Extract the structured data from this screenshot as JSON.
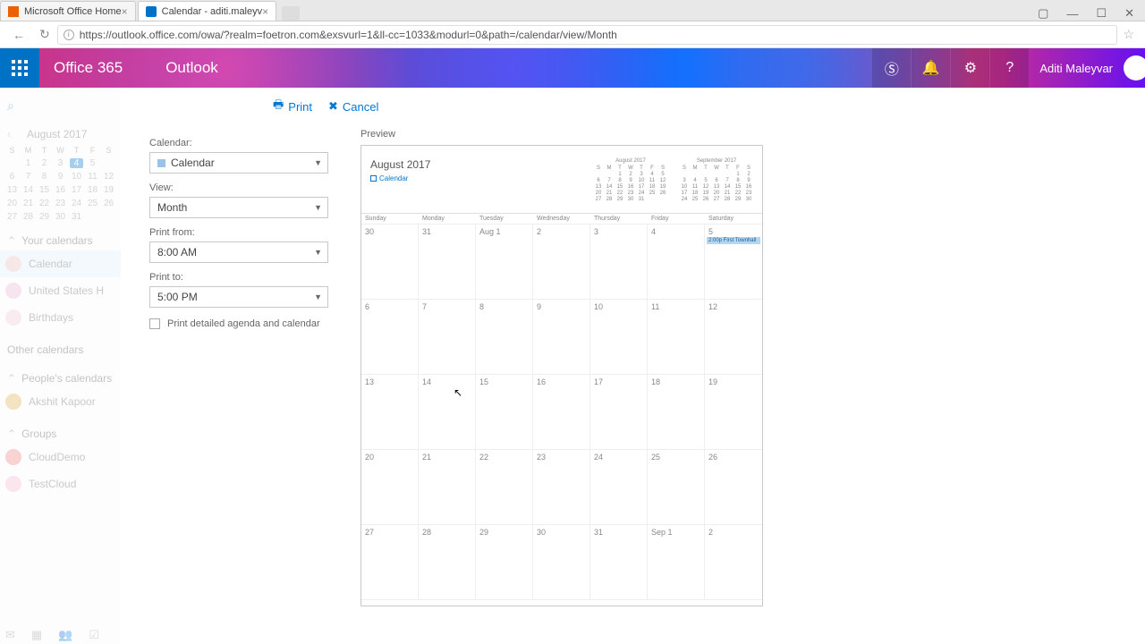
{
  "browser": {
    "tabs": [
      {
        "title": "Microsoft Office Home"
      },
      {
        "title": "Calendar - aditi.maleyv"
      }
    ],
    "url": "https://outlook.office.com/owa/?realm=foetron.com&exsvurl=1&ll-cc=1033&modurl=0&path=/calendar/view/Month"
  },
  "header": {
    "brand": "Office 365",
    "app": "Outlook",
    "user": "Aditi Maleyvar"
  },
  "toolbar": {
    "print": "Print",
    "cancel": "Cancel"
  },
  "form": {
    "calendar_label": "Calendar:",
    "calendar_value": "Calendar",
    "view_label": "View:",
    "view_value": "Month",
    "from_label": "Print from:",
    "from_value": "8:00 AM",
    "to_label": "Print to:",
    "to_value": "5:00 PM",
    "detailed": "Print detailed agenda and calendar"
  },
  "preview": {
    "label": "Preview",
    "month_title": "August 2017",
    "legend": "Calendar",
    "thumb1_title": "August 2017",
    "thumb2_title": "September 2017",
    "event_text": "2:00p First Townhall",
    "dow": [
      "Sunday",
      "Monday",
      "Tuesday",
      "Wednesday",
      "Thursday",
      "Friday",
      "Saturday"
    ],
    "weeks": [
      [
        "30",
        "31",
        "Aug 1",
        "2",
        "3",
        "4",
        "5"
      ],
      [
        "6",
        "7",
        "8",
        "9",
        "10",
        "11",
        "12"
      ],
      [
        "13",
        "14",
        "15",
        "16",
        "17",
        "18",
        "19"
      ],
      [
        "20",
        "21",
        "22",
        "23",
        "24",
        "25",
        "26"
      ],
      [
        "27",
        "28",
        "29",
        "30",
        "31",
        "Sep 1",
        "2"
      ]
    ]
  },
  "sidebar": {
    "month": "August 2017",
    "today": "4",
    "dow": [
      "S",
      "M",
      "T",
      "W",
      "T",
      "F",
      "S"
    ],
    "rows": [
      [
        "",
        "1",
        "2",
        "3",
        "4",
        "5",
        ""
      ],
      [
        "6",
        "7",
        "8",
        "9",
        "10",
        "11",
        "12"
      ],
      [
        "13",
        "14",
        "15",
        "16",
        "17",
        "18",
        "19"
      ],
      [
        "20",
        "21",
        "22",
        "23",
        "24",
        "25",
        "26"
      ],
      [
        "27",
        "28",
        "29",
        "30",
        "31",
        "",
        ""
      ]
    ],
    "your_cal": "Your calendars",
    "cal1": "Calendar",
    "cal2": "United States H",
    "cal3": "Birthdays",
    "other": "Other calendars",
    "people": "People's calendars",
    "person1": "Akshit Kapoor",
    "groups": "Groups",
    "g1": "CloudDemo",
    "g2": "TestCloud"
  }
}
